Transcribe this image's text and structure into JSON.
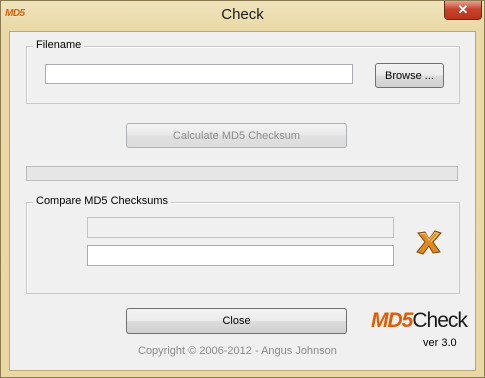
{
  "window": {
    "title": "Check",
    "icon_label": "MD5",
    "close_label": "✕"
  },
  "filename_group": {
    "label": "Filename",
    "value": "",
    "browse_label": "Browse ..."
  },
  "calculate_button": {
    "label": "Calculate MD5 Checksum",
    "enabled": false
  },
  "progress": {
    "value": 0
  },
  "compare_group": {
    "label": "Compare MD5 Checksums",
    "checksum_1": "",
    "checksum_2": "",
    "status_icon": "x-mismatch-icon"
  },
  "footer": {
    "close_label": "Close",
    "copyright": "Copyright © 2006-2012 - Angus Johnson",
    "logo_md5": "MD5",
    "logo_check": "Check",
    "version": "ver 3.0"
  },
  "colors": {
    "logo_orange": "#e35b00",
    "titlebar": "#ead9a6"
  }
}
